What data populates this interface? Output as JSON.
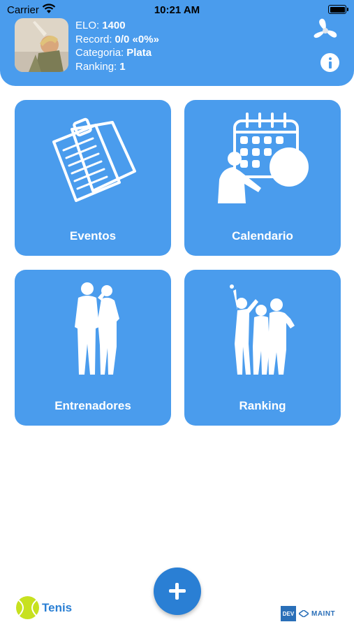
{
  "status_bar": {
    "carrier": "Carrier",
    "time": "10:21 AM"
  },
  "profile": {
    "elo_label": "ELO:",
    "elo_value": "1400",
    "record_label": "Record:",
    "record_value": "0/0 «0%»",
    "category_label": "Categoria:",
    "category_value": "Plata",
    "ranking_label": "Ranking:",
    "ranking_value": "1"
  },
  "tiles": [
    {
      "label": "Eventos",
      "icon": "clipboard-notes-icon"
    },
    {
      "label": "Calendario",
      "icon": "calendar-presenter-icon"
    },
    {
      "label": "Entrenadores",
      "icon": "trainers-silhouette-icon"
    },
    {
      "label": "Ranking",
      "icon": "cheering-group-icon"
    }
  ],
  "footer": {
    "sport_label": "Tenis",
    "brand_badge": "DEV",
    "brand_name": "MAINT"
  },
  "colors": {
    "primary": "#4a9ced",
    "accent": "#2a7fd4",
    "brand": "#2a6fb8",
    "ball": "#c7e11f"
  }
}
